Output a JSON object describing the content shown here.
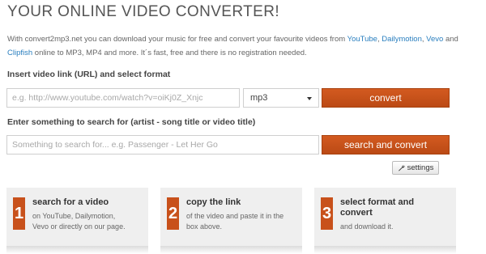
{
  "header": {
    "title": "YOUR ONLINE VIDEO CONVERTER!"
  },
  "intro": {
    "part1": "With convert2mp3.net you can download your music for free and convert your favourite videos from ",
    "link_youtube": "YouTube",
    "sep1": ", ",
    "link_dailymotion": "Dailymotion",
    "sep2": ", ",
    "link_vevo": "Vevo",
    "part2": " and ",
    "link_clipfish": "Clipfish",
    "part3": " online to MP3, MP4 and more. It´s fast, free and there is no registration needed."
  },
  "convert_section": {
    "label": "Insert video link (URL) and select format",
    "url_placeholder": "e.g. http://www.youtube.com/watch?v=oiKj0Z_Xnjc",
    "format_selected": "mp3",
    "convert_button": "convert"
  },
  "search_section": {
    "label": "Enter something to search for (artist - song title or video title)",
    "search_placeholder": "Something to search for... e.g.  Passenger - Let Her Go",
    "search_button": "search and convert",
    "settings_button": "settings"
  },
  "steps": [
    {
      "number": "1",
      "title": "search for a video",
      "desc_line1": "on YouTube, Dailymotion,",
      "desc_line2": "Vevo or directly on our page."
    },
    {
      "number": "2",
      "title": "copy the link",
      "desc_line1": "of the video and paste it in the",
      "desc_line2": "box above."
    },
    {
      "number": "3",
      "title_line1": "select format and",
      "title_line2": "convert",
      "desc_line1": "and download it."
    }
  ],
  "colors": {
    "accent": "#c8511b",
    "link": "#2a7fbf",
    "panel": "#efefef"
  },
  "icons": {
    "settings": "wrench-icon",
    "select_caret": "caret-down-icon"
  }
}
